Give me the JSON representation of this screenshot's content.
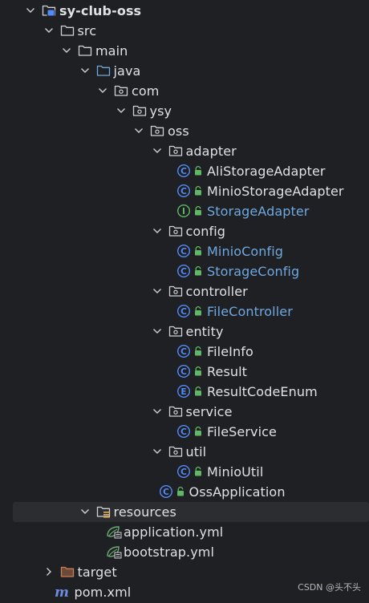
{
  "project_tree": {
    "items": [
      {
        "label": "sy-club-oss",
        "type": "module",
        "state": "open",
        "depth": 0,
        "bold": true
      },
      {
        "label": "src",
        "type": "folder",
        "state": "open",
        "depth": 1
      },
      {
        "label": "main",
        "type": "folder",
        "state": "open",
        "depth": 2
      },
      {
        "label": "java",
        "type": "source-folder",
        "state": "open",
        "depth": 3
      },
      {
        "label": "com",
        "type": "package",
        "state": "open",
        "depth": 4
      },
      {
        "label": "ysy",
        "type": "package",
        "state": "open",
        "depth": 5
      },
      {
        "label": "oss",
        "type": "package",
        "state": "open",
        "depth": 6
      },
      {
        "label": "adapter",
        "type": "package",
        "state": "open",
        "depth": 7
      },
      {
        "label": "AliStorageAdapter",
        "type": "class",
        "depth": 8
      },
      {
        "label": "MinioStorageAdapter",
        "type": "class",
        "depth": 8
      },
      {
        "label": "StorageAdapter",
        "type": "interface",
        "depth": 8,
        "modified": true
      },
      {
        "label": "config",
        "type": "package",
        "state": "open",
        "depth": 7
      },
      {
        "label": "MinioConfig",
        "type": "class",
        "depth": 8,
        "modified": true
      },
      {
        "label": "StorageConfig",
        "type": "class",
        "depth": 8,
        "modified": true
      },
      {
        "label": "controller",
        "type": "package",
        "state": "open",
        "depth": 7
      },
      {
        "label": "FileController",
        "type": "class",
        "depth": 8,
        "modified": true
      },
      {
        "label": "entity",
        "type": "package",
        "state": "open",
        "depth": 7
      },
      {
        "label": "FileInfo",
        "type": "class",
        "depth": 8
      },
      {
        "label": "Result",
        "type": "class",
        "depth": 8
      },
      {
        "label": "ResultCodeEnum",
        "type": "enum",
        "depth": 8
      },
      {
        "label": "service",
        "type": "package",
        "state": "open",
        "depth": 7
      },
      {
        "label": "FileService",
        "type": "class",
        "depth": 8
      },
      {
        "label": "util",
        "type": "package",
        "state": "open",
        "depth": 7
      },
      {
        "label": "MinioUtil",
        "type": "class",
        "depth": 8
      },
      {
        "label": "OssApplication",
        "type": "app-class",
        "depth": 7
      },
      {
        "label": "resources",
        "type": "resources-folder",
        "state": "open",
        "depth": 3,
        "selected": true
      },
      {
        "label": "application.yml",
        "type": "spring-yml",
        "depth": 4
      },
      {
        "label": "bootstrap.yml",
        "type": "spring-yml",
        "depth": 4
      },
      {
        "label": "target",
        "type": "excluded-folder",
        "state": "closed",
        "depth": 1
      },
      {
        "label": "pom.xml",
        "type": "maven",
        "depth": 1
      }
    ]
  },
  "watermark": "CSDN @头不头",
  "colors": {
    "background": "#1f2023",
    "text": "#dfe1e5",
    "modified_text": "#6fa8e0",
    "class_icon": "#548af7",
    "access_lock": "#5fb865",
    "interface_icon": "#5fb865",
    "excluded_folder": "#c77d55",
    "spring": "#6aab73",
    "maven": "#6c8ce0"
  }
}
